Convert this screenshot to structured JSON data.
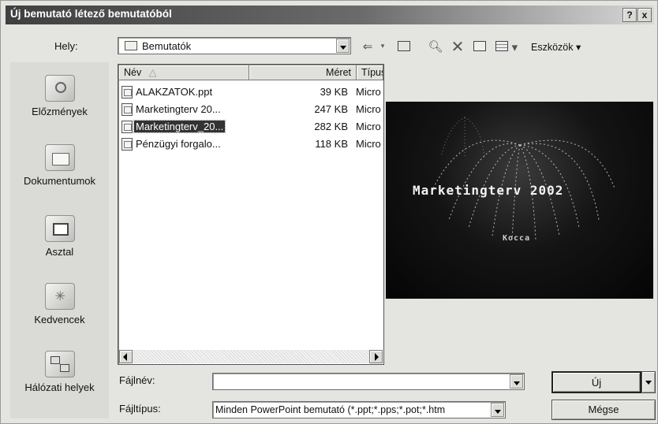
{
  "window": {
    "title": "Új bemutató létező bemutatóból",
    "help_label": "?",
    "close_label": "x"
  },
  "toolbar": {
    "location_label": "Hely:",
    "location_value": "Bemutatók",
    "tools_label": "Eszközök"
  },
  "places": [
    {
      "label": "Előzmények",
      "icon": "history-icon"
    },
    {
      "label": "Dokumentumok",
      "icon": "documents-icon"
    },
    {
      "label": "Asztal",
      "icon": "desktop-icon"
    },
    {
      "label": "Kedvencek",
      "icon": "favorites-icon"
    },
    {
      "label": "Hálózati helyek",
      "icon": "network-places-icon"
    }
  ],
  "file_list": {
    "columns": [
      "Név",
      "Méret",
      "Típus"
    ],
    "files": [
      {
        "name": "ALAKZATOK.ppt",
        "size": "39 KB",
        "type": "Micro"
      },
      {
        "name": "Marketingterv 20...",
        "size": "247 KB",
        "type": "Micro"
      },
      {
        "name": "Marketingterv_20...",
        "size": "282 KB",
        "type": "Micro",
        "selected": true
      },
      {
        "name": "Pénzügyi forgalo...",
        "size": "118 KB",
        "type": "Micro"
      }
    ]
  },
  "preview": {
    "title": "Marketingterv 2002",
    "subtitle": "Kocca"
  },
  "filename": {
    "label": "Fájlnév:",
    "value": ""
  },
  "filetype": {
    "label": "Fájltípus:",
    "value": "Minden PowerPoint bemutató (*.ppt;*.pps;*.pot;*.htm"
  },
  "buttons": {
    "new_label": "Új",
    "cancel_label": "Mégse"
  }
}
